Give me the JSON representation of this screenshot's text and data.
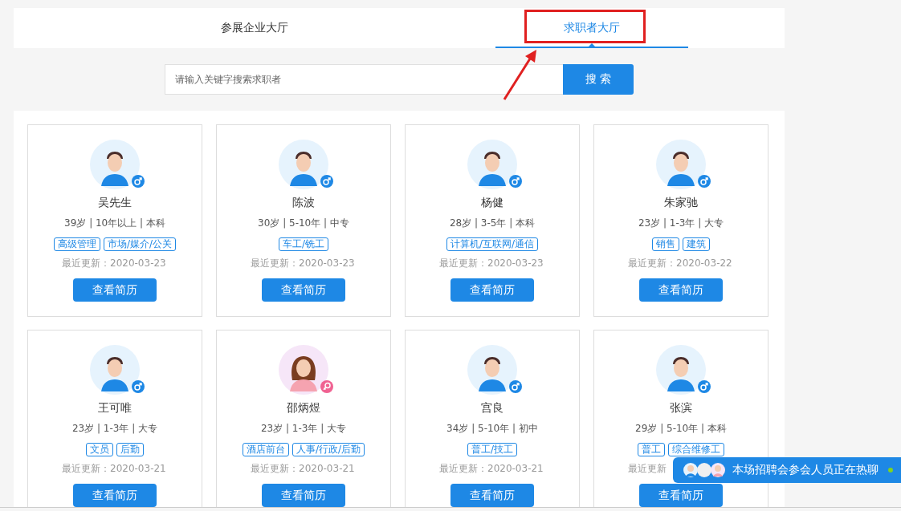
{
  "tabs": [
    {
      "label": "参展企业大厅",
      "selected": false
    },
    {
      "label": "求职者大厅",
      "selected": true
    }
  ],
  "search": {
    "placeholder": "请输入关键字搜索求职者",
    "button": "搜 索"
  },
  "candidates": [
    {
      "name": "吴先生",
      "kind": "male",
      "info": "39岁 | 10年以上 | 本科",
      "tags": [
        "高级管理",
        "市场/媒介/公关"
      ],
      "updated": "最近更新：2020-03-23",
      "button": "查看简历"
    },
    {
      "name": "陈波",
      "kind": "male",
      "info": "30岁 | 5-10年 | 中专",
      "tags": [
        "车工/铣工"
      ],
      "updated": "最近更新：2020-03-23",
      "button": "查看简历"
    },
    {
      "name": "杨健",
      "kind": "male",
      "info": "28岁 | 3-5年 | 本科",
      "tags": [
        "计算机/互联网/通信"
      ],
      "updated": "最近更新：2020-03-23",
      "button": "查看简历"
    },
    {
      "name": "朱家驰",
      "kind": "male",
      "info": "23岁 | 1-3年 | 大专",
      "tags": [
        "销售",
        "建筑"
      ],
      "updated": "最近更新：2020-03-22",
      "button": "查看简历"
    },
    {
      "name": "王可唯",
      "kind": "male",
      "info": "23岁 | 1-3年 | 大专",
      "tags": [
        "文员",
        "后勤"
      ],
      "updated": "最近更新：2020-03-21",
      "button": "查看简历"
    },
    {
      "name": "邵炳煜",
      "kind": "female",
      "info": "23岁 | 1-3年 | 大专",
      "tags": [
        "酒店前台",
        "人事/行政/后勤"
      ],
      "updated": "最近更新：2020-03-21",
      "button": "查看简历"
    },
    {
      "name": "宫良",
      "kind": "male",
      "info": "34岁 | 5-10年 | 初中",
      "tags": [
        "普工/技工"
      ],
      "updated": "最近更新：2020-03-21",
      "button": "查看简历"
    },
    {
      "name": "张滨",
      "kind": "male",
      "info": "29岁 | 5-10年 | 本科",
      "tags": [
        "普工",
        "综合维修工"
      ],
      "updated": "最近更新",
      "button": "查看简历"
    }
  ],
  "chat_bar": {
    "text": "本场招聘会参会人员正在热聊",
    "online": true
  }
}
